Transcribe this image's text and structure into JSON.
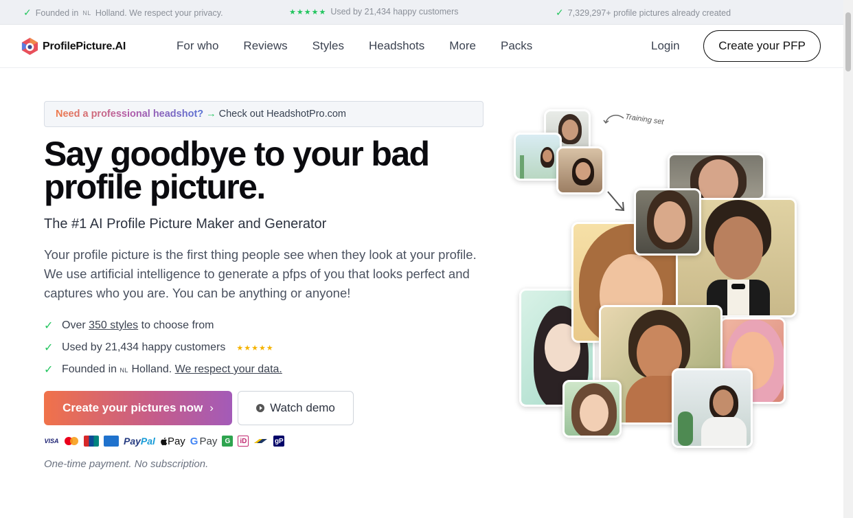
{
  "topbar": {
    "founded": {
      "text": "Founded in",
      "country": "NL",
      "tail": "Holland. We respect your privacy."
    },
    "customers": "Used by 21,434 happy customers",
    "stars": "★★★★★",
    "created": "7,329,297+ profile pictures already created"
  },
  "header": {
    "brand": "ProfilePicture.AI",
    "nav": [
      "For who",
      "Reviews",
      "Styles",
      "Headshots",
      "More",
      "Packs"
    ],
    "login": "Login",
    "cta": "Create your PFP"
  },
  "hero": {
    "promo": {
      "highlight": "Need a professional headshot?",
      "arrow": "→",
      "link": "Check out HeadshotPro.com"
    },
    "headline": "Say goodbye to your bad profile picture.",
    "subhead": "The #1 AI Profile Picture Maker and Generator",
    "intro": "Your profile picture is the first thing people see when they look at your profile. We use artificial intelligence to generate a pfps of you that looks perfect and captures who you are. You can be anything or anyone!",
    "features": {
      "styles": {
        "pre": "Over",
        "link": "350 styles",
        "post": "to choose from"
      },
      "customers": {
        "text": "Used by 21,434 happy customers",
        "stars": "★★★★★"
      },
      "founded": {
        "pre": "Founded in",
        "country": "NL",
        "mid": "Holland.",
        "link": "We respect your data."
      }
    },
    "primary_button": "Create your pictures now",
    "primary_chevron": "›",
    "secondary_button": "Watch demo",
    "payments": {
      "visa": "VISA",
      "paypal_a": "Pay",
      "paypal_b": "Pal",
      "applepay": "Pay",
      "gpay": "Pay"
    },
    "note": "One-time payment. No subscription."
  },
  "collage": {
    "training_label": "Training set"
  },
  "colors": {
    "accent_green": "#22c55e",
    "gradient_start": "#f0724a",
    "gradient_end": "#a35bb8",
    "star_gold": "#f5b301"
  }
}
